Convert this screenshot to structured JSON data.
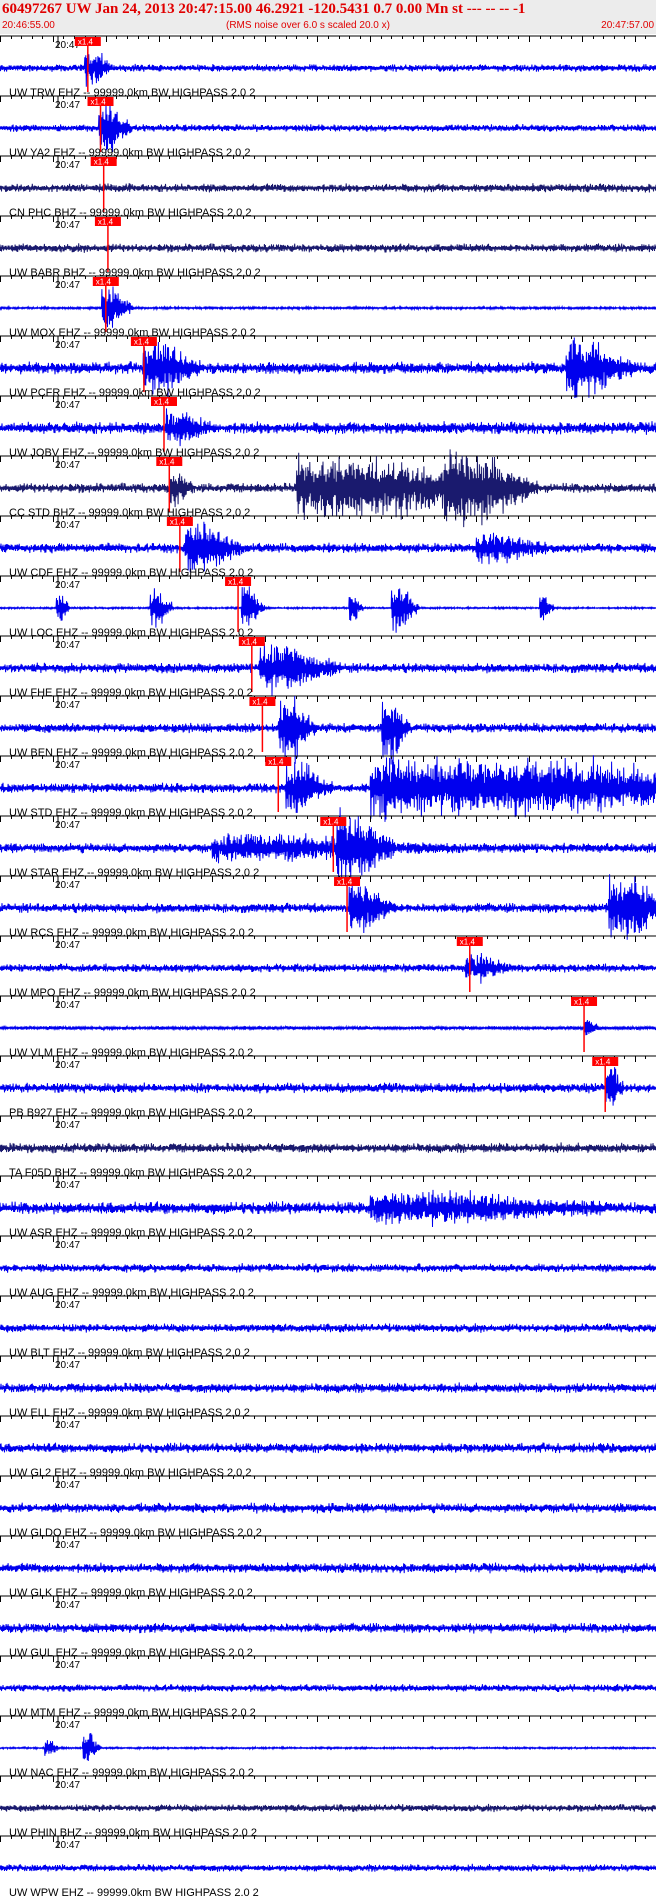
{
  "header": {
    "title": "60497267 UW Jan 24, 2013 20:47:15.00   46.2921 -120.5431  0.7 0.00 Mn st --- -- --  -1",
    "start_time": "20:46:55.00",
    "note": "(RMS noise over 6.0 s scaled 20.0 x)",
    "end_time": "20:47:57.00"
  },
  "colors": {
    "trace_blue": "#0000ee",
    "trace_navy": "#1a1a6e",
    "pick_red": "#ff0000",
    "label": "#000000"
  },
  "chart_data": {
    "type": "line",
    "x_range": [
      "20:46:55.00",
      "20:47:57.00"
    ],
    "time_tick_label": "20:47",
    "pick_label": "x1.4",
    "traces": [
      {
        "label": "UW TRW EHZ -- 99999.0km BW  HIGHPASS  2.0  2",
        "color": "blue",
        "pick_s": 8.3,
        "amp": 3,
        "bursts": [
          [
            8.0,
            1.2,
            14
          ]
        ]
      },
      {
        "label": "UW YA2 EHZ -- 99999.0km BW  HIGHPASS  2.0  2",
        "color": "blue",
        "pick_s": 9.5,
        "amp": 3,
        "bursts": [
          [
            9.3,
            1.4,
            22
          ]
        ]
      },
      {
        "label": "CN PHC BHZ -- 99999.0km BW  HIGHPASS  2.0  2",
        "color": "navy",
        "pick_s": 9.8,
        "amp": 3.5,
        "bursts": []
      },
      {
        "label": "UW BABR BHZ -- 99999.0km BW  HIGHPASS  2.0  2",
        "color": "navy",
        "pick_s": 10.2,
        "amp": 3.5,
        "bursts": []
      },
      {
        "label": "UW MOX EHZ -- 99999.0km BW  HIGHPASS  2.0  2",
        "color": "blue",
        "pick_s": 10.0,
        "amp": 1,
        "bursts": [
          [
            9.6,
            1.4,
            18
          ]
        ]
      },
      {
        "label": "UW PCFR EHZ -- 99999.0km BW  HIGHPASS  2.0  2",
        "color": "blue",
        "pick_s": 13.6,
        "amp": 5,
        "bursts": [
          [
            13.5,
            2.5,
            18
          ],
          [
            53.5,
            3.0,
            20
          ]
        ]
      },
      {
        "label": "UW JOBV EHZ -- 99999.0km BW  HIGHPASS  2.0  2",
        "color": "blue",
        "pick_s": 15.5,
        "amp": 5,
        "bursts": [
          [
            15.6,
            2.0,
            10
          ]
        ]
      },
      {
        "label": "CC STD BHZ -- 99999.0km BW  HIGHPASS  2.0  2",
        "color": "navy",
        "pick_s": 16.0,
        "amp": 4,
        "bursts": [
          [
            16.0,
            1.0,
            12
          ],
          [
            28.0,
            10.0,
            22
          ],
          [
            42.0,
            4.0,
            20
          ]
        ]
      },
      {
        "label": "UW CDF EHZ -- 99999.0km BW  HIGHPASS  2.0  2",
        "color": "blue",
        "pick_s": 17.0,
        "amp": 4,
        "bursts": [
          [
            17.5,
            2.5,
            18
          ],
          [
            45.0,
            3.0,
            10
          ]
        ]
      },
      {
        "label": "UW LOC EHZ -- 99999.0km BW  HIGHPASS  2.0  2",
        "color": "blue",
        "pick_s": 22.5,
        "amp": 0.8,
        "bursts": [
          [
            5.3,
            0.6,
            14
          ],
          [
            14.2,
            1.0,
            18
          ],
          [
            22.8,
            1.0,
            18
          ],
          [
            33.0,
            0.6,
            12
          ],
          [
            37.0,
            1.2,
            20
          ],
          [
            51.0,
            0.6,
            12
          ]
        ]
      },
      {
        "label": "UW FHE EHZ -- 99999.0km BW  HIGHPASS  2.0  2",
        "color": "blue",
        "pick_s": 23.8,
        "amp": 4,
        "bursts": [
          [
            24.5,
            3.5,
            16
          ]
        ]
      },
      {
        "label": "UW BEN EHZ -- 99999.0km BW  HIGHPASS  2.0  2",
        "color": "blue",
        "pick_s": 24.8,
        "amp": 4,
        "bursts": [
          [
            26.3,
            1.6,
            24
          ],
          [
            36.1,
            1.2,
            24
          ]
        ]
      },
      {
        "label": "UW STD EHZ -- 99999.0km BW  HIGHPASS  2.0  2",
        "color": "blue",
        "pick_s": 26.3,
        "amp": 4,
        "bursts": [
          [
            27.0,
            2.0,
            18
          ],
          [
            35.0,
            20.0,
            20
          ]
        ]
      },
      {
        "label": "UW STAR EHZ -- 99999.0km BW  HIGHPASS  2.0  2",
        "color": "blue",
        "pick_s": 31.5,
        "amp": 4,
        "bursts": [
          [
            31.8,
            2.5,
            22
          ],
          [
            20.0,
            10.0,
            8
          ]
        ]
      },
      {
        "label": "UW RCS EHZ -- 99999.0km BW  HIGHPASS  2.0  2",
        "color": "blue",
        "pick_s": 32.8,
        "amp": 4,
        "bursts": [
          [
            33.0,
            2.0,
            18
          ],
          [
            57.5,
            3.0,
            22
          ]
        ]
      },
      {
        "label": "UW MPO EHZ -- 99999.0km BW  HIGHPASS  2.0  2",
        "color": "blue",
        "pick_s": 44.4,
        "amp": 3.5,
        "bursts": [
          [
            44.0,
            2.0,
            8
          ]
        ]
      },
      {
        "label": "UW VLM EHZ -- 99999.0km BW  HIGHPASS  2.0  2",
        "color": "blue",
        "pick_s": 55.2,
        "amp": 1.5,
        "bursts": [
          [
            55.2,
            0.6,
            10
          ]
        ]
      },
      {
        "label": "PB B927 EHZ -- 99999.0km BW  HIGHPASS  2.0  2",
        "color": "blue",
        "pick_s": 57.2,
        "amp": 4,
        "bursts": [
          [
            57.2,
            0.8,
            18
          ]
        ]
      },
      {
        "label": "TA F05D BHZ -- 99999.0km BW  HIGHPASS  2.0  2",
        "color": "navy",
        "pick_s": null,
        "amp": 4,
        "bursts": []
      },
      {
        "label": "UW ASR EHZ -- 99999.0km BW  HIGHPASS  2.0  2",
        "color": "blue",
        "pick_s": null,
        "amp": 5,
        "bursts": [
          [
            35.0,
            10.0,
            9
          ]
        ]
      },
      {
        "label": "UW AUG EHZ -- 99999.0km BW  HIGHPASS  2.0  2",
        "color": "blue",
        "pick_s": null,
        "amp": 3.5,
        "bursts": []
      },
      {
        "label": "UW BLT EHZ -- 99999.0km BW  HIGHPASS  2.0  2",
        "color": "blue",
        "pick_s": null,
        "amp": 3.5,
        "bursts": []
      },
      {
        "label": "UW ELL EHZ -- 99999.0km BW  HIGHPASS  2.0  2",
        "color": "blue",
        "pick_s": null,
        "amp": 4,
        "bursts": []
      },
      {
        "label": "UW GL2 EHZ -- 99999.0km BW  HIGHPASS  2.0  2",
        "color": "blue",
        "pick_s": null,
        "amp": 4,
        "bursts": []
      },
      {
        "label": "UW GLDO EHZ -- 99999.0km BW  HIGHPASS  2.0  2",
        "color": "blue",
        "pick_s": null,
        "amp": 4,
        "bursts": []
      },
      {
        "label": "UW GLK EHZ -- 99999.0km BW  HIGHPASS  2.0  2",
        "color": "blue",
        "pick_s": null,
        "amp": 4,
        "bursts": []
      },
      {
        "label": "UW GUL EHZ -- 99999.0km BW  HIGHPASS  2.0  2",
        "color": "blue",
        "pick_s": null,
        "amp": 4,
        "bursts": []
      },
      {
        "label": "UW MTM EHZ -- 99999.0km BW  HIGHPASS  2.0  2",
        "color": "blue",
        "pick_s": null,
        "amp": 3,
        "bursts": []
      },
      {
        "label": "UW NAC EHZ -- 99999.0km BW  HIGHPASS  2.0  2",
        "color": "blue",
        "pick_s": null,
        "amp": 0.8,
        "bursts": [
          [
            4.2,
            0.6,
            10
          ],
          [
            7.8,
            0.8,
            14
          ]
        ]
      },
      {
        "label": "UW PHIN BHZ -- 99999.0km BW  HIGHPASS  2.0  2",
        "color": "navy",
        "pick_s": null,
        "amp": 3,
        "bursts": []
      },
      {
        "label": "UW WPW EHZ -- 99999.0km BW  HIGHPASS  2.0  2",
        "color": "blue",
        "pick_s": null,
        "amp": 3,
        "bursts": []
      }
    ]
  }
}
